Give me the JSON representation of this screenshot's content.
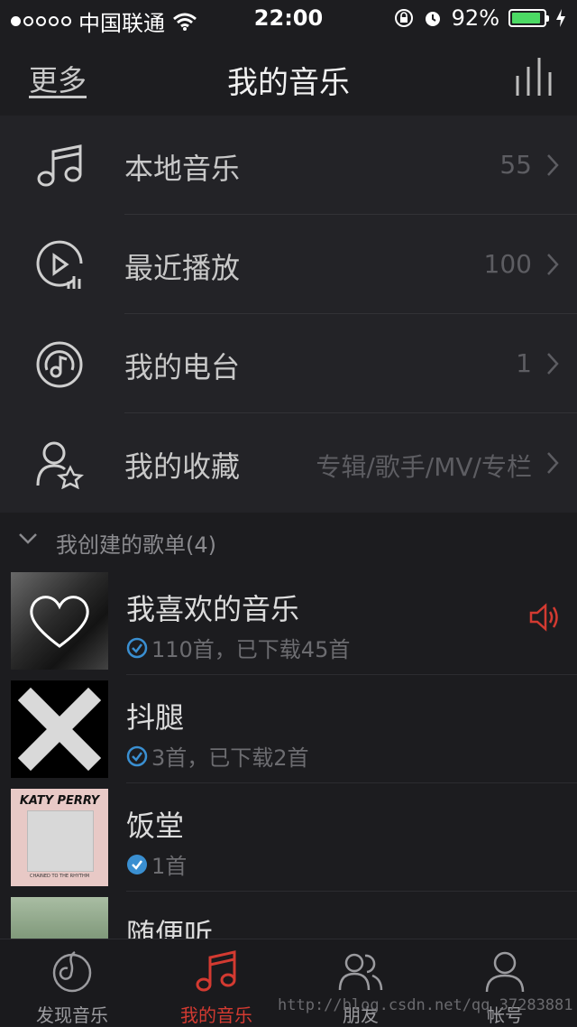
{
  "status_bar": {
    "carrier": "中国联通",
    "time": "22:00",
    "battery_text": "92%",
    "battery_level": 0.92,
    "signal_filled": 1,
    "signal_total": 5,
    "icons": [
      "wifi-icon",
      "rotation-lock-icon",
      "alarm-icon",
      "battery-icon",
      "charging-bolt-icon"
    ]
  },
  "nav": {
    "more": "更多",
    "title": "我的音乐",
    "right_icon": "equalizer-icon"
  },
  "menu": [
    {
      "label": "本地音乐",
      "value": "55",
      "icon": "music-note-icon"
    },
    {
      "label": "最近播放",
      "value": "100",
      "icon": "recent-play-icon"
    },
    {
      "label": "我的电台",
      "value": "1",
      "icon": "radio-icon"
    },
    {
      "label": "我的收藏",
      "value": "专辑/歌手/MV/专栏",
      "icon": "user-star-icon"
    }
  ],
  "section": {
    "title": "我创建的歌单(4)",
    "icon": "chevron-down-icon"
  },
  "playlists": [
    {
      "name": "我喜欢的音乐",
      "sub": "110首，已下载45首",
      "cover": "heart-overlay-cover",
      "playing": true
    },
    {
      "name": "抖腿",
      "sub": "3首，已下载2首",
      "cover": "x-cover"
    },
    {
      "name": "饭堂",
      "sub": "1首",
      "cover_text": "KATY PERRY",
      "cover_caption": "CHAINED TO THE RHYTHM"
    },
    {
      "name": "随便听",
      "sub": "",
      "cover": "landscape-cover"
    }
  ],
  "tabs": [
    {
      "label": "发现音乐",
      "icon": "discover-icon",
      "active": false
    },
    {
      "label": "我的音乐",
      "icon": "music-note-icon",
      "active": true
    },
    {
      "label": "朋友",
      "icon": "friends-icon",
      "active": false
    },
    {
      "label": "帐号",
      "icon": "account-icon",
      "active": false
    }
  ],
  "colors": {
    "accent": "#d33a31",
    "check": "#3a8fd1",
    "background": "#1c1c1f",
    "battery": "#4cd964"
  },
  "watermark": "http://blog.csdn.net/qq_37283881"
}
